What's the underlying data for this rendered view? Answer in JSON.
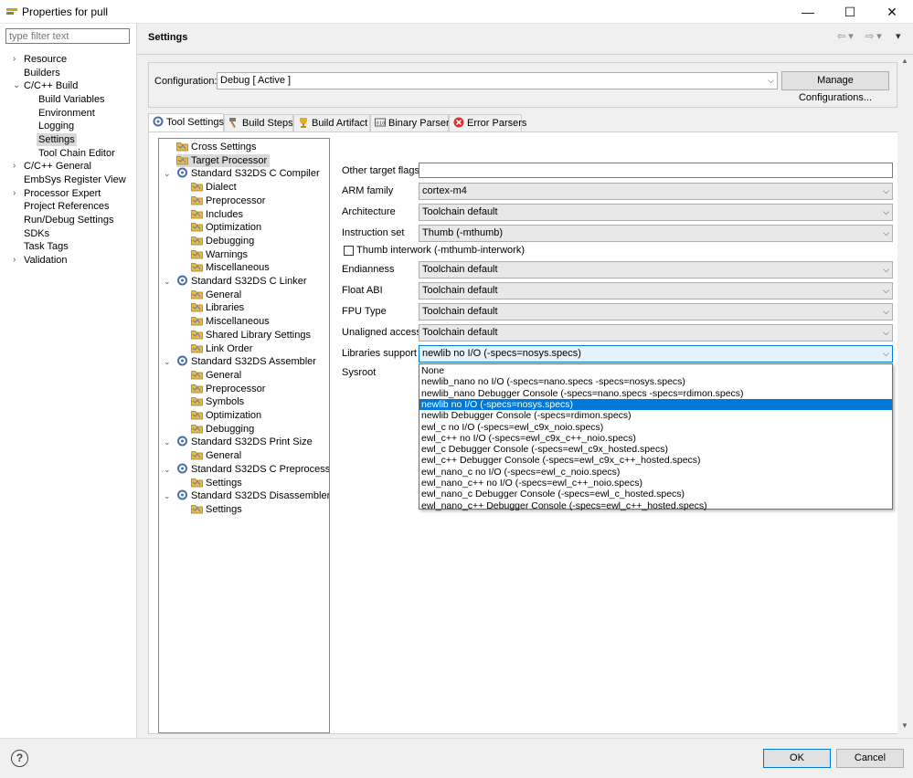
{
  "window": {
    "title": "Properties for pull",
    "minimize": "—",
    "maximize": "☐",
    "close": "✕"
  },
  "filter": {
    "placeholder": "type filter text"
  },
  "nav": {
    "items": [
      {
        "label": "Resource",
        "caret": "›"
      },
      {
        "label": "Builders"
      },
      {
        "label": "C/C++ Build",
        "caret": "⌄"
      },
      {
        "label": "Build Variables"
      },
      {
        "label": "Environment"
      },
      {
        "label": "Logging"
      },
      {
        "label": "Settings"
      },
      {
        "label": "Tool Chain Editor"
      },
      {
        "label": "C/C++ General",
        "caret": "›"
      },
      {
        "label": "EmbSys Register View"
      },
      {
        "label": "Processor Expert",
        "caret": "›"
      },
      {
        "label": "Project References"
      },
      {
        "label": "Run/Debug Settings"
      },
      {
        "label": "SDKs"
      },
      {
        "label": "Task Tags"
      },
      {
        "label": "Validation",
        "caret": "›"
      }
    ]
  },
  "header": {
    "title": "Settings",
    "back": "⇦ ▾",
    "forward": "⇨ ▾",
    "menu": "▾"
  },
  "configuration": {
    "label": "Configuration:",
    "value": "Debug  [ Active ]",
    "manage_button": "Manage Configurations..."
  },
  "tabs": [
    {
      "label": "Tool Settings"
    },
    {
      "label": "Build Steps"
    },
    {
      "label": "Build Artifact"
    },
    {
      "label": "Binary Parsers"
    },
    {
      "label": "Error Parsers"
    }
  ],
  "tree": {
    "nodes": [
      {
        "label": "Cross Settings"
      },
      {
        "label": "Target Processor"
      },
      {
        "label": "Standard S32DS C Compiler"
      },
      {
        "label": "Dialect"
      },
      {
        "label": "Preprocessor"
      },
      {
        "label": "Includes"
      },
      {
        "label": "Optimization"
      },
      {
        "label": "Debugging"
      },
      {
        "label": "Warnings"
      },
      {
        "label": "Miscellaneous"
      },
      {
        "label": "Standard S32DS C Linker"
      },
      {
        "label": "General"
      },
      {
        "label": "Libraries"
      },
      {
        "label": "Miscellaneous"
      },
      {
        "label": "Shared Library Settings"
      },
      {
        "label": "Link Order"
      },
      {
        "label": "Standard S32DS Assembler"
      },
      {
        "label": "General"
      },
      {
        "label": "Preprocessor"
      },
      {
        "label": "Symbols"
      },
      {
        "label": "Optimization"
      },
      {
        "label": "Debugging"
      },
      {
        "label": "Standard S32DS Print Size"
      },
      {
        "label": "General"
      },
      {
        "label": "Standard S32DS C Preprocessor"
      },
      {
        "label": "Settings"
      },
      {
        "label": "Standard S32DS Disassembler"
      },
      {
        "label": "Settings"
      }
    ]
  },
  "form": {
    "other_flags_label": "Other target flags",
    "other_flags_value": "",
    "arm_family_label": "ARM family",
    "arm_family_value": "cortex-m4",
    "architecture_label": "Architecture",
    "architecture_value": "Toolchain default",
    "instruction_set_label": "Instruction set",
    "instruction_set_value": "Thumb (-mthumb)",
    "thumb_interwork_label": "Thumb interwork (-mthumb-interwork)",
    "endianness_label": "Endianness",
    "endianness_value": "Toolchain default",
    "float_abi_label": "Float ABI",
    "float_abi_value": "Toolchain default",
    "fpu_type_label": "FPU Type",
    "fpu_type_value": "Toolchain default",
    "unaligned_label": "Unaligned access",
    "unaligned_value": "Toolchain default",
    "libraries_label": "Libraries support",
    "libraries_value": "newlib no I/O (-specs=nosys.specs)",
    "sysroot_label": "Sysroot"
  },
  "dropdown": {
    "options": [
      "None",
      "newlib_nano no I/O (-specs=nano.specs -specs=nosys.specs)",
      "newlib_nano Debugger Console (-specs=nano.specs -specs=rdimon.specs)",
      "newlib no I/O (-specs=nosys.specs)",
      "newlib Debugger Console (-specs=rdimon.specs)",
      "ewl_c no I/O (-specs=ewl_c9x_noio.specs)",
      "ewl_c++ no I/O (-specs=ewl_c9x_c++_noio.specs)",
      "ewl_c Debugger Console (-specs=ewl_c9x_hosted.specs)",
      "ewl_c++ Debugger Console (-specs=ewl_c9x_c++_hosted.specs)",
      "ewl_nano_c no I/O (-specs=ewl_c_noio.specs)",
      "ewl_nano_c++ no I/O (-specs=ewl_c++_noio.specs)",
      "ewl_nano_c Debugger Console (-specs=ewl_c_hosted.specs)",
      "ewl_nano_c++ Debugger Console (-specs=ewl_c++_hosted.specs)"
    ],
    "selected_index": 3
  },
  "footer": {
    "help": "?",
    "ok": "OK",
    "cancel": "Cancel"
  },
  "colors": {
    "selection": "#0078d7",
    "folder": "#e8b84a"
  }
}
